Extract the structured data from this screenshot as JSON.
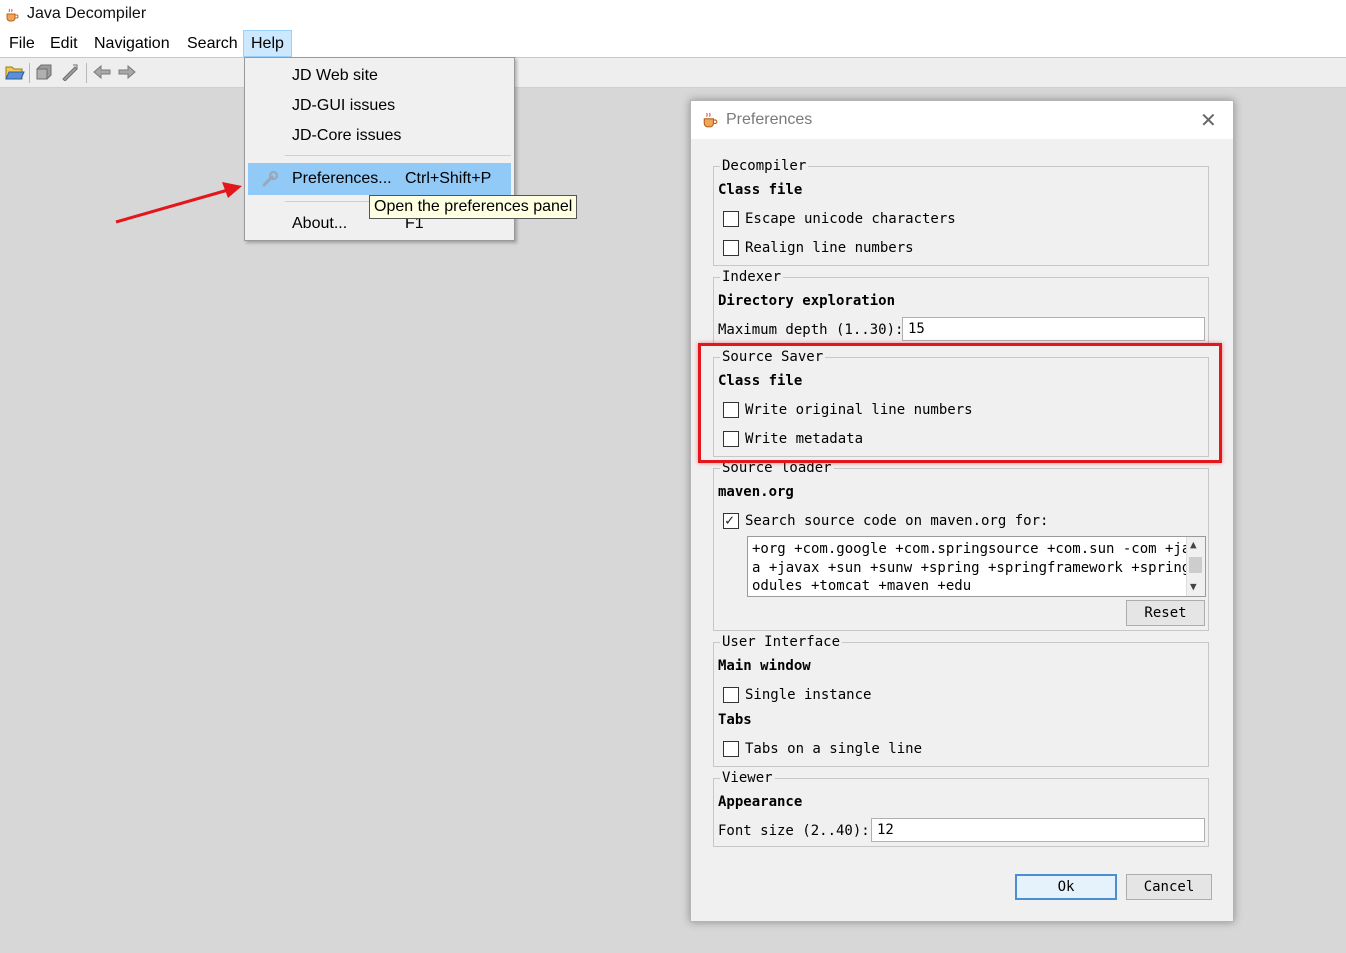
{
  "window": {
    "title": "Java Decompiler",
    "icon": "coffee-cup-icon"
  },
  "menubar": {
    "items": [
      "File",
      "Edit",
      "Navigation",
      "Search",
      "Help"
    ],
    "active": "Help"
  },
  "toolbar": {
    "icons": [
      "open-file-icon",
      "save-icon",
      "save-all-icon",
      "back-arrow-icon",
      "forward-arrow-icon"
    ]
  },
  "help_menu": {
    "items": [
      {
        "label": "JD Web site"
      },
      {
        "label": "JD-GUI issues"
      },
      {
        "label": "JD-Core issues"
      },
      {
        "label": "Preferences...",
        "accelerator": "Ctrl+Shift+P",
        "icon": "wrench-icon",
        "highlighted": true
      },
      {
        "label": "About...",
        "accelerator": "F1"
      }
    ]
  },
  "tooltip": "Open the preferences panel",
  "annotations": {
    "arrow_color": "#e3161b",
    "highlight_color": "#e3161b"
  },
  "preferences": {
    "title": "Preferences",
    "decompiler": {
      "title": "Decompiler",
      "subtitle": "Class file",
      "escape_unicode": {
        "label": "Escape unicode characters",
        "checked": false
      },
      "realign_lines": {
        "label": "Realign line numbers",
        "checked": false
      }
    },
    "indexer": {
      "title": "Indexer",
      "subtitle": "Directory exploration",
      "max_depth_label": "Maximum depth (1..30):",
      "max_depth_value": "15"
    },
    "source_saver": {
      "title": "Source Saver",
      "subtitle": "Class file",
      "write_line_numbers": {
        "label": "Write original line numbers",
        "checked": false
      },
      "write_metadata": {
        "label": "Write metadata",
        "checked": false
      }
    },
    "source_loader": {
      "title": "Source loader",
      "subtitle": "maven.org",
      "search_source": {
        "label": "Search source code on maven.org for:",
        "checked": true
      },
      "patterns": "+org +com.google +com.springsource +com.sun -com +jav\na +javax +sun +sunw +spring +springframework +springm\nodules +tomcat +maven +edu",
      "reset_label": "Reset"
    },
    "user_interface": {
      "title": "User Interface",
      "main_window_subtitle": "Main window",
      "single_instance": {
        "label": "Single instance",
        "checked": false
      },
      "tabs_subtitle": "Tabs",
      "tabs_single_line": {
        "label": "Tabs on a single line",
        "checked": false
      }
    },
    "viewer": {
      "title": "Viewer",
      "subtitle": "Appearance",
      "font_size_label": "Font size (2..40):",
      "font_size_value": "12"
    },
    "ok_label": "Ok",
    "cancel_label": "Cancel"
  }
}
